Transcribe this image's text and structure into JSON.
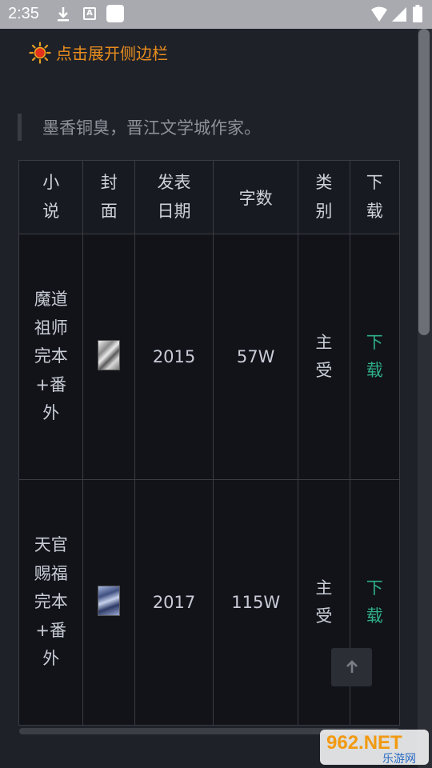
{
  "status_bar": {
    "time": "2:35",
    "icons": [
      "download-icon",
      "a-notification-icon",
      "app-square-icon",
      "wifi-icon",
      "signal-icon",
      "battery-icon"
    ]
  },
  "sidebar_toggle": {
    "icon": "sun-icon",
    "label": "点击展开侧边栏",
    "color": "#e88e1e"
  },
  "quote": {
    "text": "墨香铜臭，晋江文学城作家。"
  },
  "table": {
    "headers": [
      "小说",
      "封面",
      "发表日期",
      "字数",
      "类别",
      "下载"
    ],
    "rows": [
      {
        "title": "魔道祖师完本+番外",
        "cover": "cover-image",
        "date": "2015",
        "words": "57W",
        "category": "主受",
        "download": "下载"
      },
      {
        "title": "天官赐福完本+番外",
        "cover": "cover-image",
        "date": "2017",
        "words": "115W",
        "category": "主受",
        "download": "下载"
      }
    ]
  },
  "back_to_top": {
    "icon": "arrow-up-icon"
  },
  "watermark": {
    "text": "962.NET",
    "sub": "乐游网"
  },
  "colors": {
    "background": "#1f2129",
    "accent_link": "#2fae8a",
    "status_bar": "#a9aab0"
  }
}
